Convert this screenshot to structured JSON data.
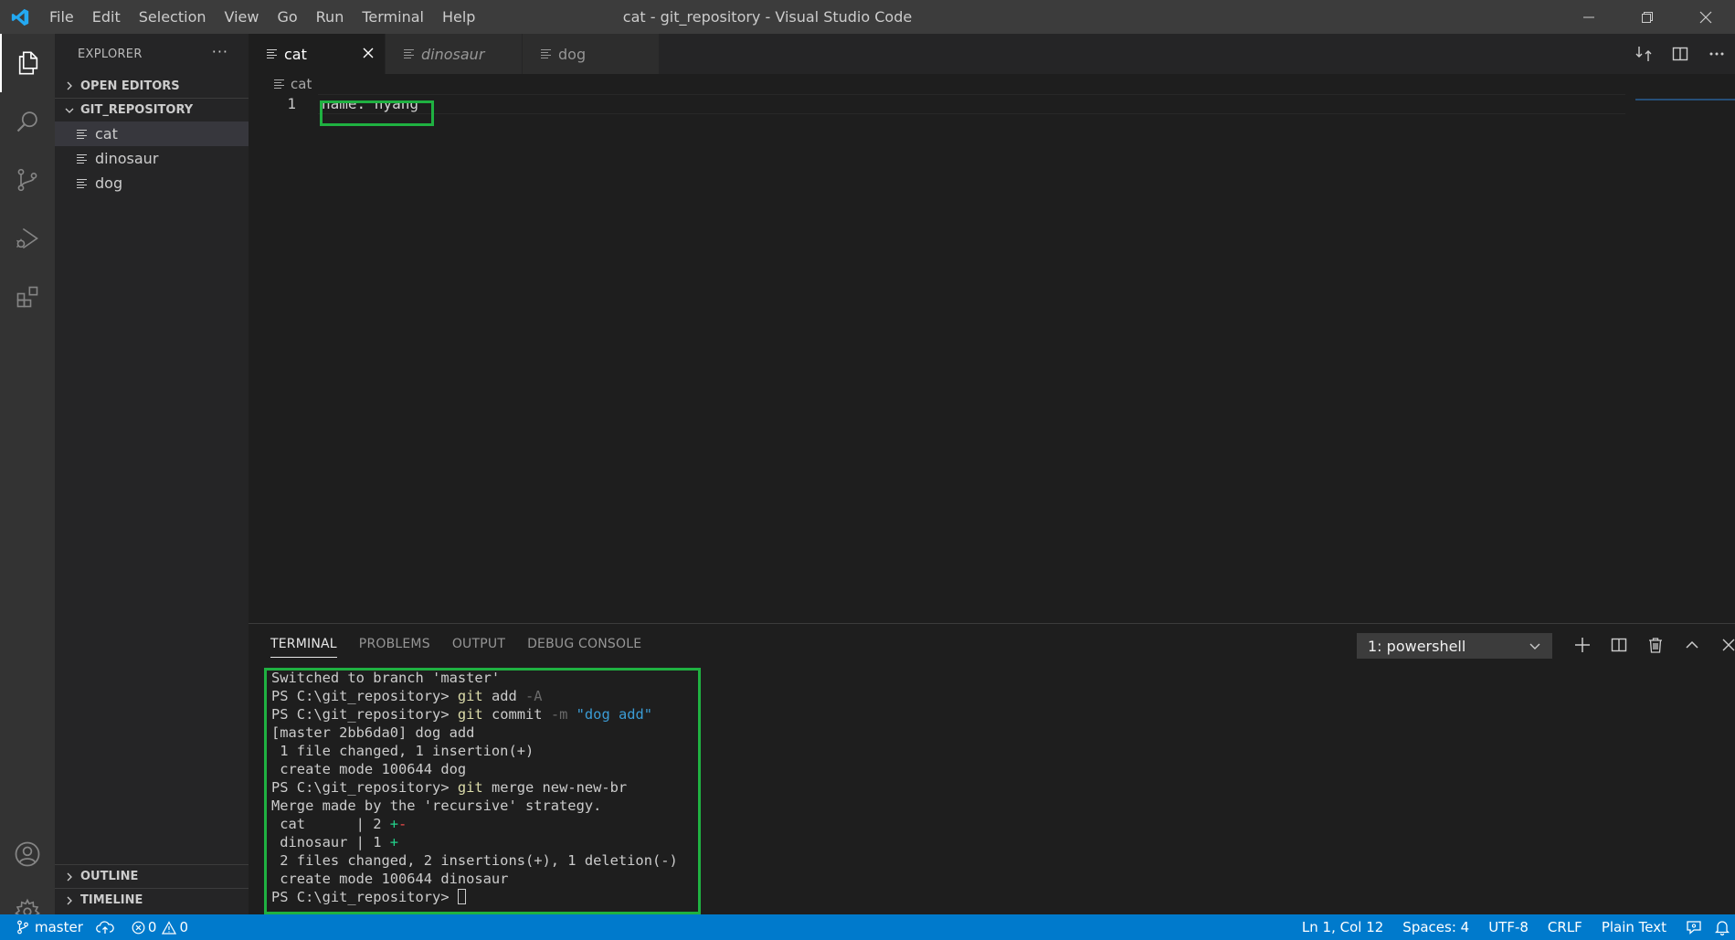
{
  "window": {
    "title": "cat - git_repository - Visual Studio Code",
    "menu": [
      "File",
      "Edit",
      "Selection",
      "View",
      "Go",
      "Run",
      "Terminal",
      "Help"
    ]
  },
  "sidebar": {
    "header": "EXPLORER",
    "more": "···",
    "open_editors": "OPEN EDITORS",
    "repo": "GIT_REPOSITORY",
    "files": [
      "cat",
      "dinosaur",
      "dog"
    ],
    "outline": "OUTLINE",
    "timeline": "TIMELINE"
  },
  "tabs": [
    {
      "label": "cat",
      "active": true
    },
    {
      "label": "dinosaur",
      "active": false
    },
    {
      "label": "dog",
      "active": false
    }
  ],
  "breadcrumb": "cat",
  "editor": {
    "line_number": "1",
    "code": "name: nyang"
  },
  "panel": {
    "tabs": [
      "TERMINAL",
      "PROBLEMS",
      "OUTPUT",
      "DEBUG CONSOLE"
    ],
    "terminal_select": "1: powershell",
    "terminal_lines": {
      "l1": "Switched to branch 'master'",
      "prompt": "PS C:\\git_repository> ",
      "git": "git",
      "l2_cmd": " add ",
      "l2_flag": "-A",
      "l3_cmd": " commit ",
      "l3_flag": "-m",
      "l3_str": "\"dog add\"",
      "l4": "[master 2bb6da0] dog add",
      "l5": " 1 file changed, 1 insertion(+)",
      "l6": " create mode 100644 dog",
      "l7_cmd": " merge new-new-br",
      "l8": "Merge made by the 'recursive' strategy.",
      "l9_name": " cat      | 2 ",
      "l9_plus": "+",
      "l9_minus": "-",
      "l10_name": " dinosaur | 1 ",
      "l10_plus": "+",
      "l11": " 2 files changed, 2 insertions(+), 1 deletion(-)",
      "l12": " create mode 100644 dinosaur"
    }
  },
  "status": {
    "branch": "master",
    "errors": "0",
    "warnings": "0",
    "position": "Ln 1, Col 12",
    "spaces": "Spaces: 4",
    "encoding": "UTF-8",
    "eol": "CRLF",
    "language": "Plain Text"
  },
  "colors": {
    "accent": "#007acc",
    "highlight_box": "#1fb141"
  }
}
